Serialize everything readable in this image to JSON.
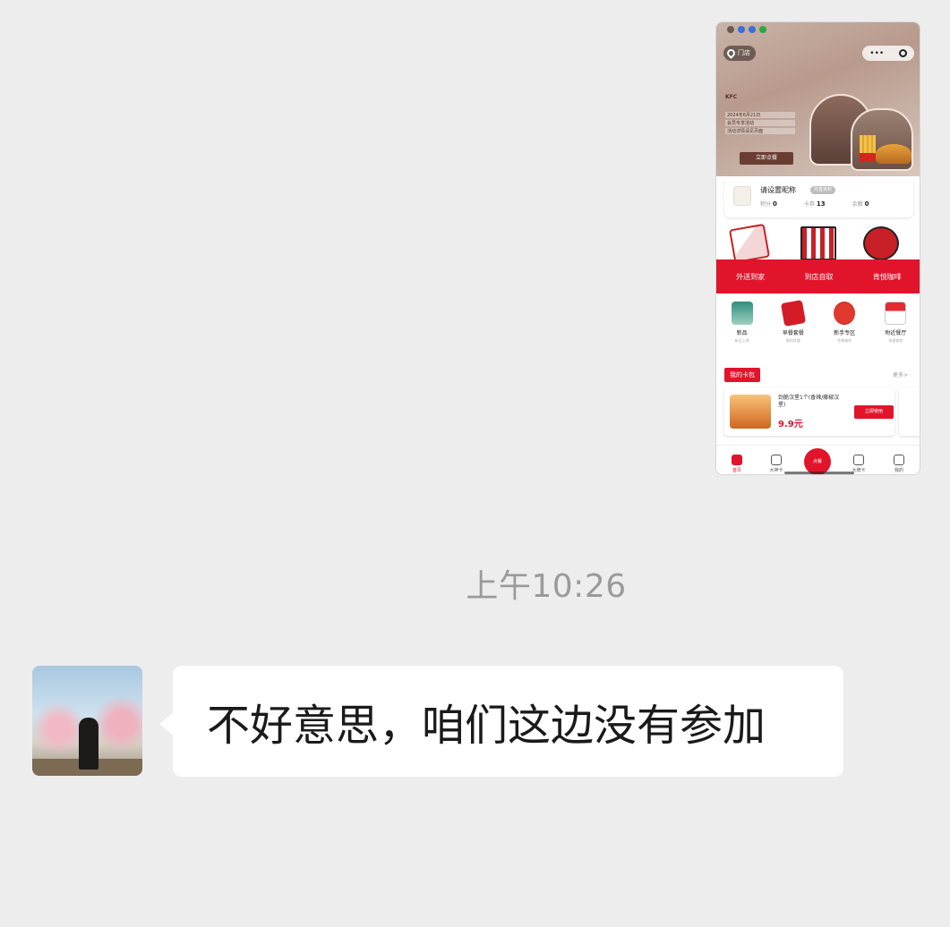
{
  "shared_screenshot": {
    "location_label": "门店",
    "capsule_more": "•••",
    "brand": "KFC",
    "promo_lines": [
      "2024年6月21日",
      "会员专享活动",
      "活动详情请见页面"
    ],
    "order_now_label": "立即点餐",
    "member": {
      "name": "请设置昵称",
      "tag": "完善资料",
      "stats": [
        {
          "label": "积分",
          "value": "0"
        },
        {
          "label": "卡券",
          "value": "13"
        },
        {
          "label": "余额",
          "value": "0"
        }
      ]
    },
    "services": [
      "外送到家",
      "到店自取",
      "肯悦咖啡"
    ],
    "shortcuts": [
      {
        "title": "新品",
        "sub": "新品上线"
      },
      {
        "title": "早餐套餐",
        "sub": "限时优惠"
      },
      {
        "title": "新手专区",
        "sub": "专属福利"
      },
      {
        "title": "附近餐厅",
        "sub": "快速查找"
      }
    ],
    "card_pack_label": "我的卡包",
    "more_label": "更多>",
    "coupon": {
      "title": "劲脆汉堡1个(香辣/藤椒汉堡)",
      "price": "9.9元",
      "action": "立即使用"
    },
    "tabs": [
      "首页",
      "大神卡",
      "点餐",
      "大牌卡",
      "我的"
    ],
    "center_tab_label": "点餐"
  },
  "timestamp": "上午10:26",
  "message": {
    "text": "不好意思，咱们这边没有参加"
  },
  "colors": {
    "chat_background": "#ededed",
    "bubble": "#ffffff",
    "kfc_red": "#e1142b",
    "timestamp_text": "#9a9a9a"
  }
}
